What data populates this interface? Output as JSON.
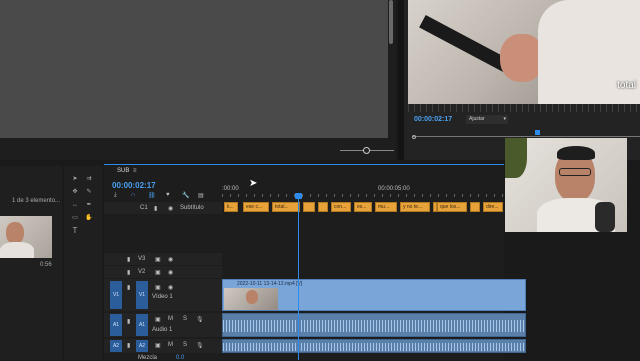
{
  "program_monitor": {
    "timecode": "00:00:02:17",
    "fit": "Ajustar",
    "caption_overlay": "total"
  },
  "project": {
    "count": "1 de 3 elemento...",
    "duration": "0:56"
  },
  "timeline": {
    "tab": "SUB",
    "timecode": "00:00:02:17",
    "ruler_start": ":00:00",
    "ruler_mid": "00:00:05:00",
    "subtitle_track": "Subtítulo",
    "cc_label": "C1",
    "tracks": [
      "V3",
      "V2",
      "V1",
      "A1",
      "A2"
    ],
    "video1_name": "Vídeo 1",
    "audio1_name": "Audio 1",
    "master_label": "Mezcla",
    "master_value": "0.0",
    "clip_name": "2022-10-11 13-14-12.mp4 [V]",
    "captions": [
      "k...",
      "ese c...",
      "total...",
      "",
      "",
      "con...",
      "es...",
      "mu...",
      "y no te...",
      "",
      "que los...",
      "",
      "dire..."
    ]
  }
}
